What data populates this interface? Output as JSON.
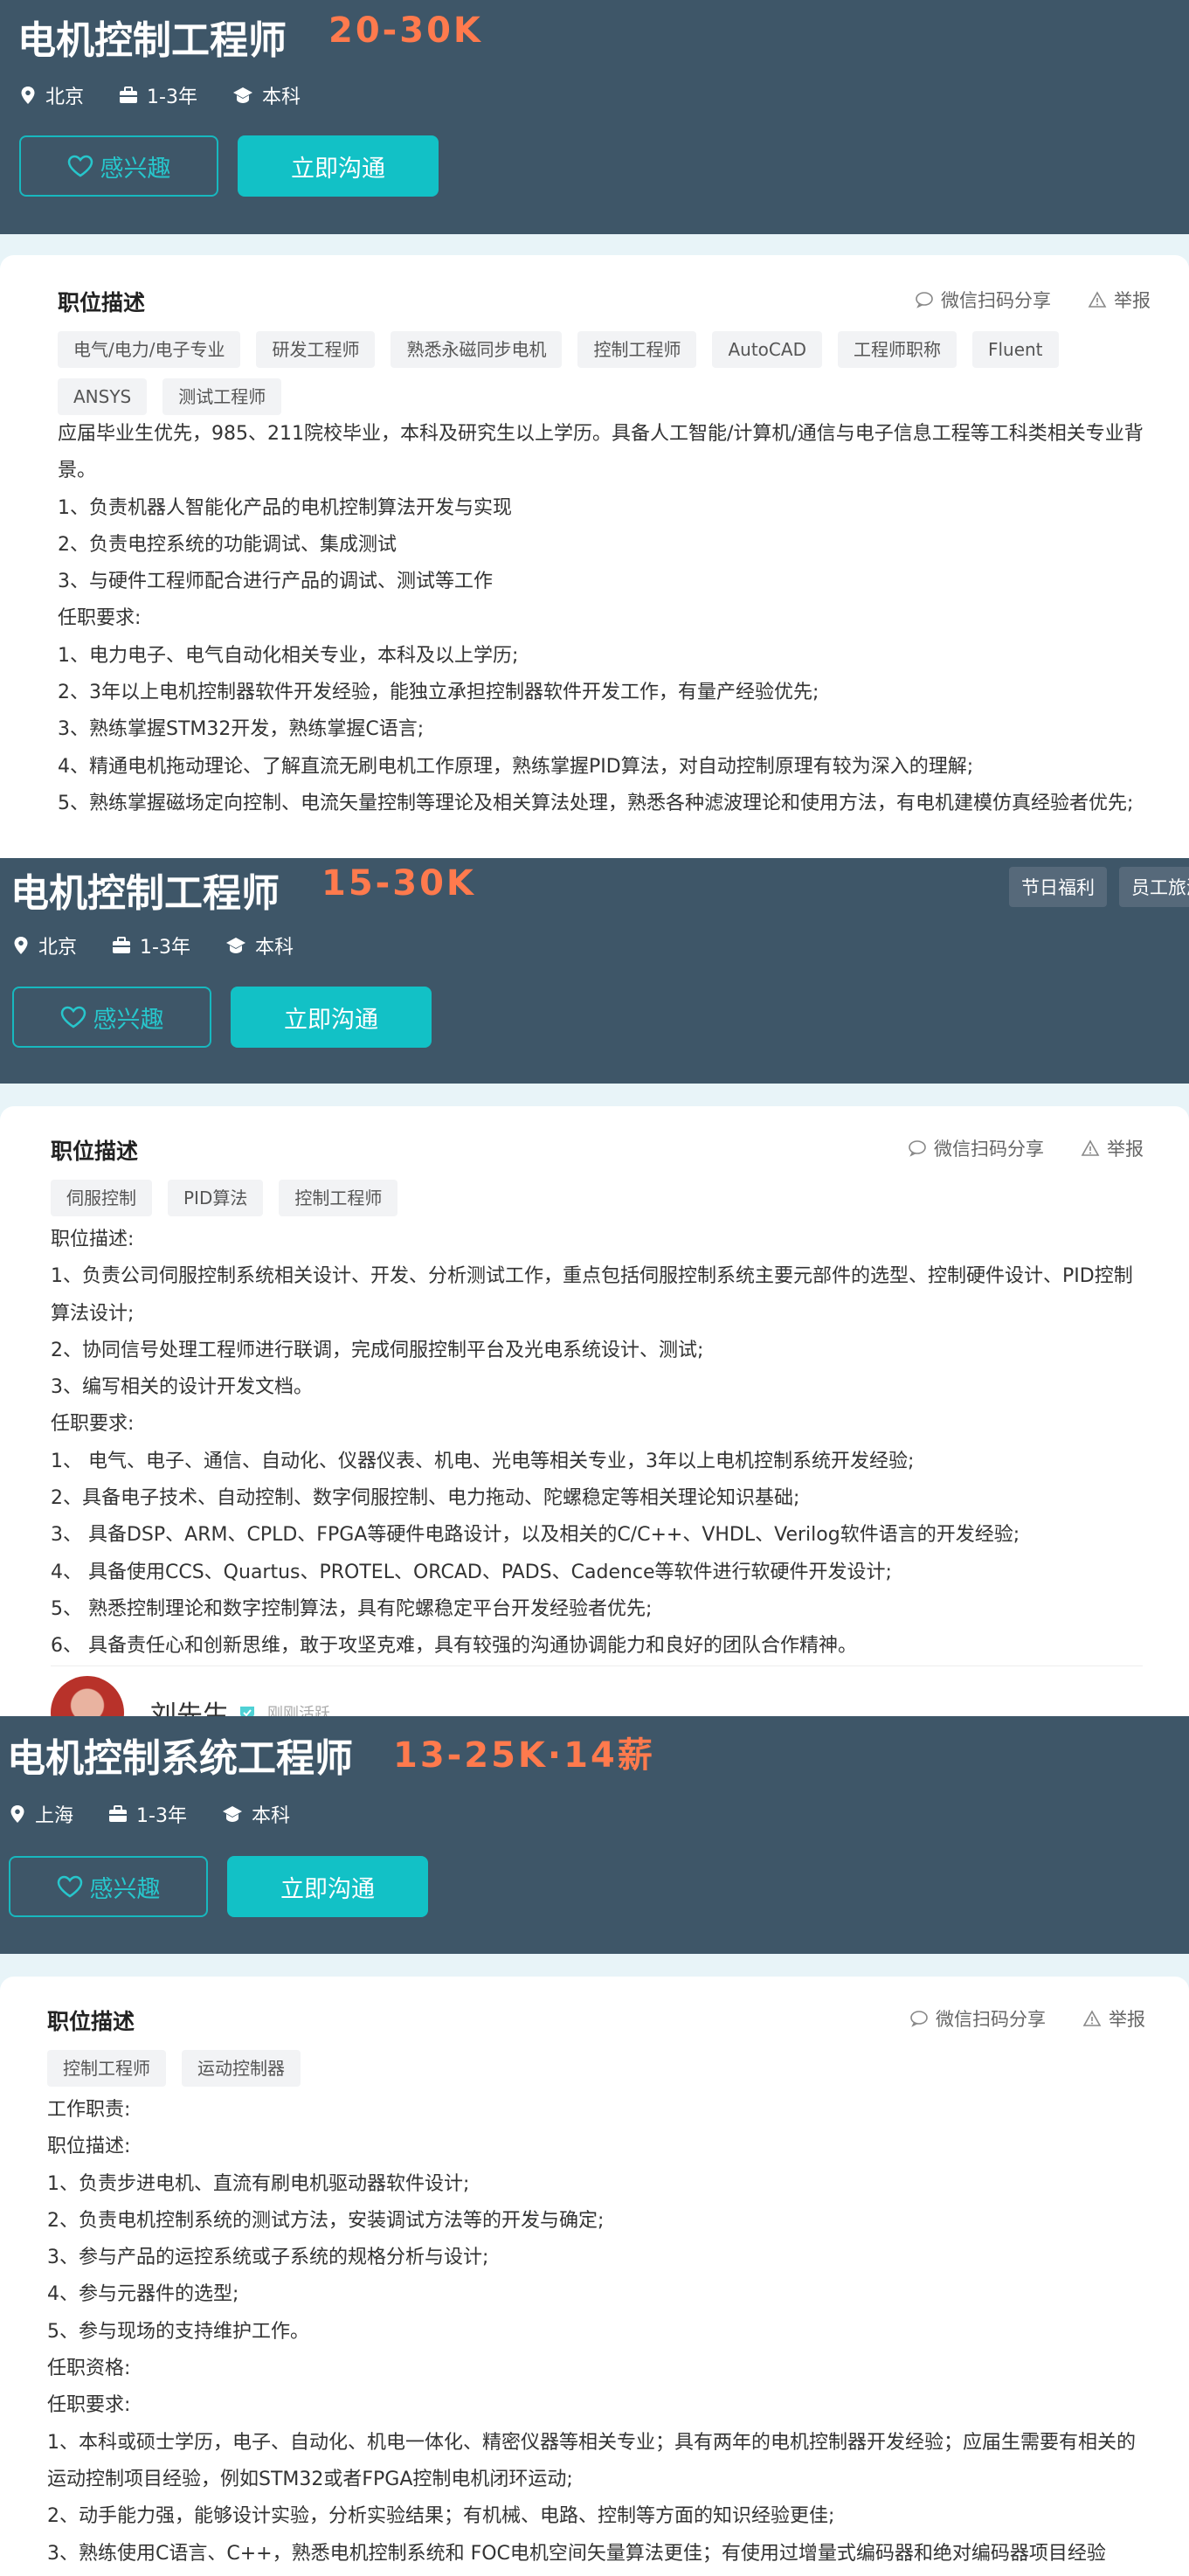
{
  "jobs": [
    {
      "title": "电机控制工程师",
      "salary": "20-30K",
      "city": "北京",
      "experience": "1-3年",
      "degree": "本科",
      "interest_label": "感兴趣",
      "chat_label": "立即沟通",
      "header_tags": [],
      "section_title": "职位描述",
      "share_label": "微信扫码分享",
      "report_label": "举报",
      "tags": [
        "电气/电力/电子专业",
        "研发工程师",
        "熟悉永磁同步电机",
        "控制工程师",
        "AutoCAD",
        "工程师职称",
        "Fluent",
        "ANSYS",
        "测试工程师"
      ],
      "description": [
        "应届毕业生优先，985、211院校毕业，本科及研究生以上学历。具备人工智能/计算机/通信与电子信息工程等工科类相关专业背景。",
        "1、负责机器人智能化产品的电机控制算法开发与实现",
        "2、负责电控系统的功能调试、集成测试",
        "3、与硬件工程师配合进行产品的调试、测试等工作",
        "任职要求:",
        "1、电力电子、电气自动化相关专业，本科及以上学历;",
        "2、3年以上电机控制器软件开发经验，能独立承担控制器软件开发工作，有量产经验优先;",
        "3、熟练掌握STM32开发，熟练掌握C语言;",
        "4、精通电机拖动理论、了解直流无刷电机工作原理，熟练掌握PID算法，对自动控制原理有较为深入的理解;",
        "5、熟练掌握磁场定向控制、电流矢量控制等理论及相关算法处理，熟悉各种滤波理论和使用方法，有电机建模仿真经验者优先;"
      ]
    },
    {
      "title": "电机控制工程师",
      "salary": "15-30K",
      "city": "北京",
      "experience": "1-3年",
      "degree": "本科",
      "interest_label": "感兴趣",
      "chat_label": "立即沟通",
      "header_tags": [
        "节日福利",
        "员工旅游"
      ],
      "section_title": "职位描述",
      "share_label": "微信扫码分享",
      "report_label": "举报",
      "tags": [
        "伺服控制",
        "PID算法",
        "控制工程师"
      ],
      "description": [
        "职位描述:",
        "1、负责公司伺服控制系统相关设计、开发、分析测试工作，重点包括伺服控制系统主要元部件的选型、控制硬件设计、PID控制算法设计;",
        "2、协同信号处理工程师进行联调，完成伺服控制平台及光电系统设计、测试;",
        "3、编写相关的设计开发文档。",
        "任职要求:",
        "1、 电气、电子、通信、自动化、仪器仪表、机电、光电等相关专业，3年以上电机控制系统开发经验;",
        "2、具备电子技术、自动控制、数字伺服控制、电力拖动、陀螺稳定等相关理论知识基础;",
        "3、 具备DSP、ARM、CPLD、FPGA等硬件电路设计，以及相关的C/C++、VHDL、Verilog软件语言的开发经验;",
        "4、 具备使用CCS、Quartus、PROTEL、ORCAD、PADS、Cadence等软件进行软硬件开发设计;",
        "5、 熟悉控制理论和数字控制算法，具有陀螺稳定平台开发经验者优先;",
        "6、 具备责任心和创新思维，敢于攻坚克难，具有较强的沟通协调能力和良好的团队合作精神。"
      ],
      "recruiter_name": "刘先生",
      "recruiter_status": "刚刚活跃"
    },
    {
      "title": "电机控制系统工程师",
      "salary": "13-25K·14薪",
      "city": "上海",
      "experience": "1-3年",
      "degree": "本科",
      "interest_label": "感兴趣",
      "chat_label": "立即沟通",
      "header_tags": [],
      "section_title": "职位描述",
      "share_label": "微信扫码分享",
      "report_label": "举报",
      "tags": [
        "控制工程师",
        "运动控制器"
      ],
      "description": [
        "工作职责:",
        "职位描述:",
        "1、负责步进电机、直流有刷电机驱动器软件设计;",
        "2、负责电机控制系统的测试方法，安装调试方法等的开发与确定;",
        "3、参与产品的运控系统或子系统的规格分析与设计;",
        "4、参与元器件的选型;",
        "5、参与现场的支持维护工作。",
        "任职资格:",
        "任职要求:",
        "1、本科或硕士学历，电子、自动化、机电一体化、精密仪器等相关专业；具有两年的电机控制器开发经验；应届生需要有相关的运动控制项目经验，例如STM32或者FPGA控制电机闭环运动;",
        "2、动手能力强，能够设计实验，分析实验结果；有机械、电路、控制等方面的知识经验更佳;",
        "3、熟练使用C语言、C++，熟悉电机控制系统和 FOC电机空间矢量算法更佳；有使用过增量式编码器和绝对编码器项目经验"
      ]
    }
  ]
}
